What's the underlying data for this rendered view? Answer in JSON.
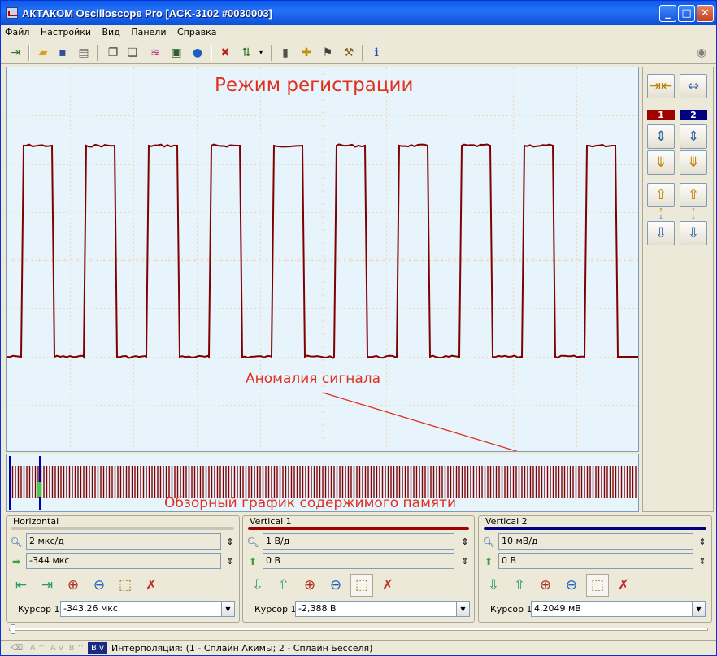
{
  "window": {
    "title": "АКТАКОМ Oscilloscope Pro [ACK-3102 #0030003]",
    "min": "_",
    "max": "□",
    "close": "✕"
  },
  "menu": [
    "Файл",
    "Настройки",
    "Вид",
    "Панели",
    "Справка"
  ],
  "plot": {
    "mode_title": "Режим регистрации",
    "anomaly_label": "Аномалия сигнала",
    "overview_label": "Обзорный график содержимого памяти",
    "colors": {
      "trace": "#800000",
      "background": "#e8f4fc",
      "grid": "#f0d8b8",
      "annotation": "#e0301e",
      "cursor": "#0000a0"
    }
  },
  "right_panel": {
    "ch1": "1",
    "ch2": "2",
    "ch1_color": "#a00000",
    "ch2_color": "#000080"
  },
  "horizontal": {
    "title": "Horizontal",
    "timebase": "2 мкс/д",
    "offset": "-344 мкс",
    "cursor_label": "Курсор 1",
    "cursor_value": "-343,26 мкс"
  },
  "vertical1": {
    "title": "Vertical 1",
    "scale": "1 В/д",
    "offset": "0 В",
    "cursor_label": "Курсор 1",
    "cursor_value": "-2,388 В"
  },
  "vertical2": {
    "title": "Vertical 2",
    "scale": "10 мВ/д",
    "offset": "0 В",
    "cursor_label": "Курсор 1",
    "cursor_value": "4,2049 мВ"
  },
  "status": {
    "btn_a_up": "A ^",
    "btn_a_down": "A v",
    "btn_b_up": "B ^",
    "btn_b_down": "B v",
    "text": "Интерполяция: (1 - Сплайн Акимы; 2 - Сплайн Бесселя)"
  }
}
